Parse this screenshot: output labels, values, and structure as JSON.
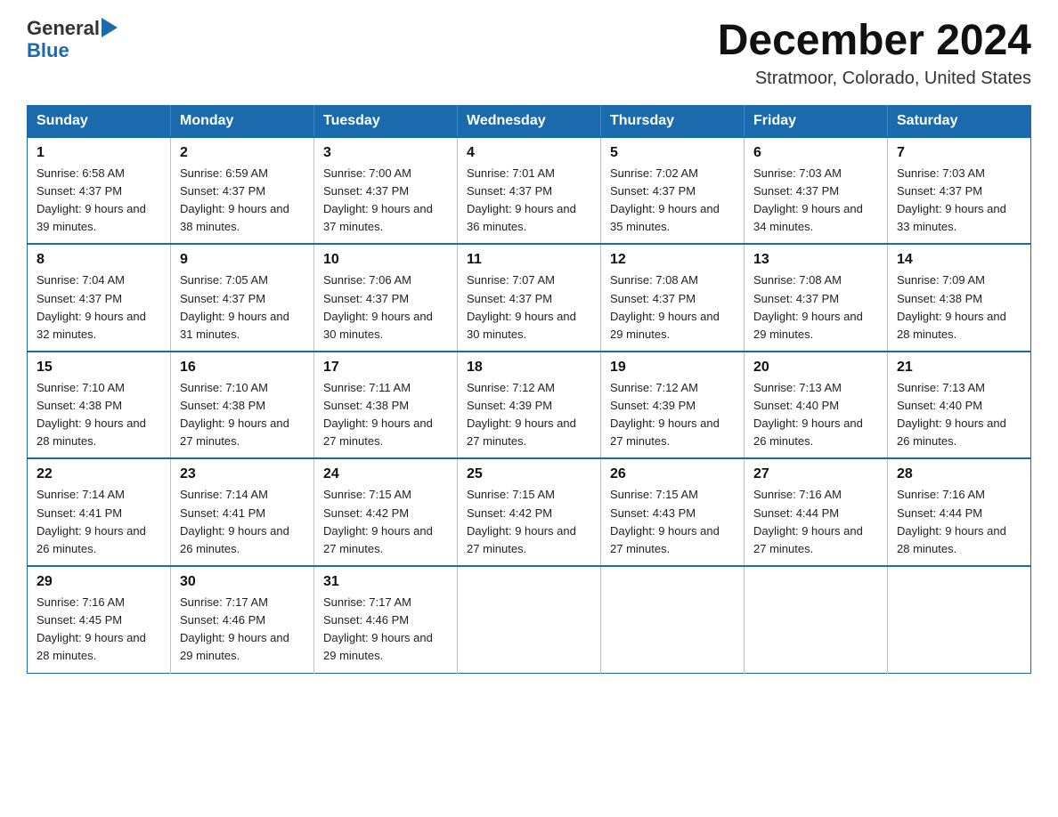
{
  "logo": {
    "text_general": "General",
    "text_blue": "Blue",
    "aria": "GeneralBlue logo"
  },
  "title": "December 2024",
  "subtitle": "Stratmoor, Colorado, United States",
  "days_of_week": [
    "Sunday",
    "Monday",
    "Tuesday",
    "Wednesday",
    "Thursday",
    "Friday",
    "Saturday"
  ],
  "weeks": [
    [
      {
        "day": "1",
        "sunrise": "6:58 AM",
        "sunset": "4:37 PM",
        "daylight": "9 hours and 39 minutes."
      },
      {
        "day": "2",
        "sunrise": "6:59 AM",
        "sunset": "4:37 PM",
        "daylight": "9 hours and 38 minutes."
      },
      {
        "day": "3",
        "sunrise": "7:00 AM",
        "sunset": "4:37 PM",
        "daylight": "9 hours and 37 minutes."
      },
      {
        "day": "4",
        "sunrise": "7:01 AM",
        "sunset": "4:37 PM",
        "daylight": "9 hours and 36 minutes."
      },
      {
        "day": "5",
        "sunrise": "7:02 AM",
        "sunset": "4:37 PM",
        "daylight": "9 hours and 35 minutes."
      },
      {
        "day": "6",
        "sunrise": "7:03 AM",
        "sunset": "4:37 PM",
        "daylight": "9 hours and 34 minutes."
      },
      {
        "day": "7",
        "sunrise": "7:03 AM",
        "sunset": "4:37 PM",
        "daylight": "9 hours and 33 minutes."
      }
    ],
    [
      {
        "day": "8",
        "sunrise": "7:04 AM",
        "sunset": "4:37 PM",
        "daylight": "9 hours and 32 minutes."
      },
      {
        "day": "9",
        "sunrise": "7:05 AM",
        "sunset": "4:37 PM",
        "daylight": "9 hours and 31 minutes."
      },
      {
        "day": "10",
        "sunrise": "7:06 AM",
        "sunset": "4:37 PM",
        "daylight": "9 hours and 30 minutes."
      },
      {
        "day": "11",
        "sunrise": "7:07 AM",
        "sunset": "4:37 PM",
        "daylight": "9 hours and 30 minutes."
      },
      {
        "day": "12",
        "sunrise": "7:08 AM",
        "sunset": "4:37 PM",
        "daylight": "9 hours and 29 minutes."
      },
      {
        "day": "13",
        "sunrise": "7:08 AM",
        "sunset": "4:37 PM",
        "daylight": "9 hours and 29 minutes."
      },
      {
        "day": "14",
        "sunrise": "7:09 AM",
        "sunset": "4:38 PM",
        "daylight": "9 hours and 28 minutes."
      }
    ],
    [
      {
        "day": "15",
        "sunrise": "7:10 AM",
        "sunset": "4:38 PM",
        "daylight": "9 hours and 28 minutes."
      },
      {
        "day": "16",
        "sunrise": "7:10 AM",
        "sunset": "4:38 PM",
        "daylight": "9 hours and 27 minutes."
      },
      {
        "day": "17",
        "sunrise": "7:11 AM",
        "sunset": "4:38 PM",
        "daylight": "9 hours and 27 minutes."
      },
      {
        "day": "18",
        "sunrise": "7:12 AM",
        "sunset": "4:39 PM",
        "daylight": "9 hours and 27 minutes."
      },
      {
        "day": "19",
        "sunrise": "7:12 AM",
        "sunset": "4:39 PM",
        "daylight": "9 hours and 27 minutes."
      },
      {
        "day": "20",
        "sunrise": "7:13 AM",
        "sunset": "4:40 PM",
        "daylight": "9 hours and 26 minutes."
      },
      {
        "day": "21",
        "sunrise": "7:13 AM",
        "sunset": "4:40 PM",
        "daylight": "9 hours and 26 minutes."
      }
    ],
    [
      {
        "day": "22",
        "sunrise": "7:14 AM",
        "sunset": "4:41 PM",
        "daylight": "9 hours and 26 minutes."
      },
      {
        "day": "23",
        "sunrise": "7:14 AM",
        "sunset": "4:41 PM",
        "daylight": "9 hours and 26 minutes."
      },
      {
        "day": "24",
        "sunrise": "7:15 AM",
        "sunset": "4:42 PM",
        "daylight": "9 hours and 27 minutes."
      },
      {
        "day": "25",
        "sunrise": "7:15 AM",
        "sunset": "4:42 PM",
        "daylight": "9 hours and 27 minutes."
      },
      {
        "day": "26",
        "sunrise": "7:15 AM",
        "sunset": "4:43 PM",
        "daylight": "9 hours and 27 minutes."
      },
      {
        "day": "27",
        "sunrise": "7:16 AM",
        "sunset": "4:44 PM",
        "daylight": "9 hours and 27 minutes."
      },
      {
        "day": "28",
        "sunrise": "7:16 AM",
        "sunset": "4:44 PM",
        "daylight": "9 hours and 28 minutes."
      }
    ],
    [
      {
        "day": "29",
        "sunrise": "7:16 AM",
        "sunset": "4:45 PM",
        "daylight": "9 hours and 28 minutes."
      },
      {
        "day": "30",
        "sunrise": "7:17 AM",
        "sunset": "4:46 PM",
        "daylight": "9 hours and 29 minutes."
      },
      {
        "day": "31",
        "sunrise": "7:17 AM",
        "sunset": "4:46 PM",
        "daylight": "9 hours and 29 minutes."
      },
      null,
      null,
      null,
      null
    ]
  ]
}
